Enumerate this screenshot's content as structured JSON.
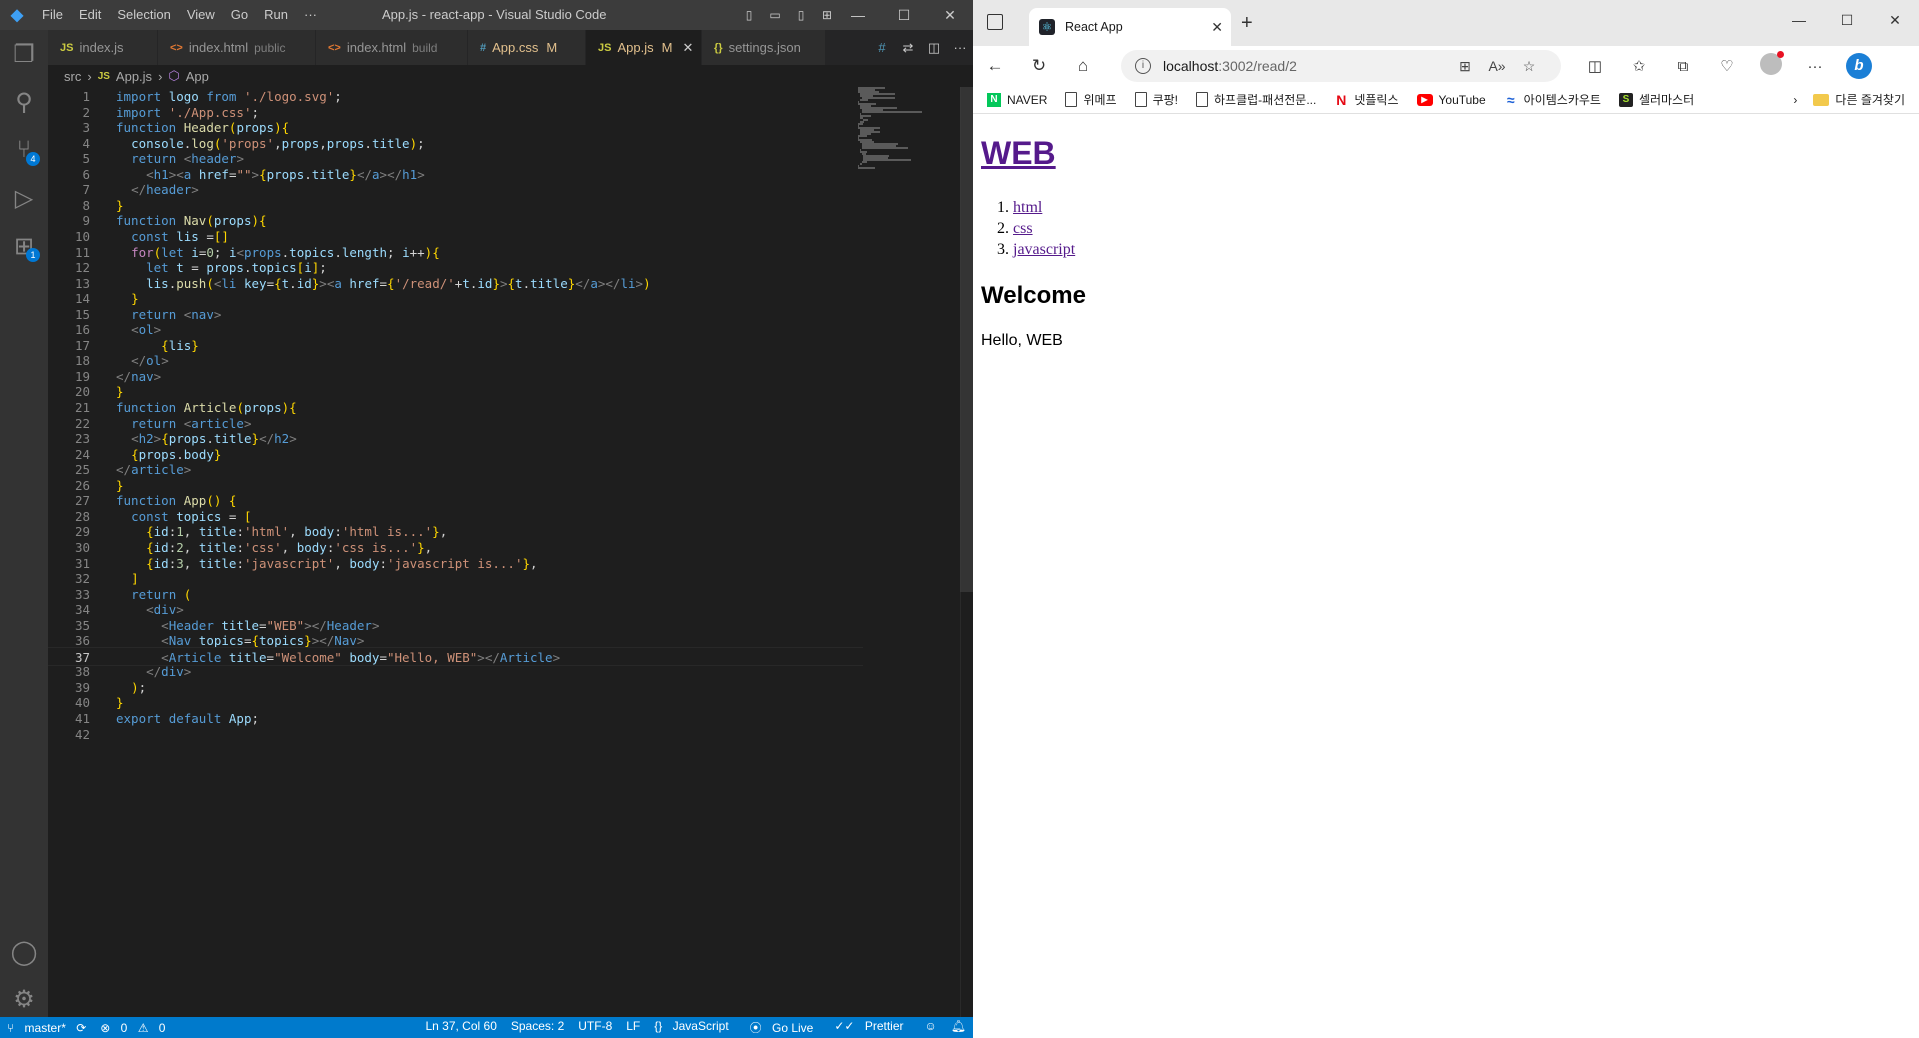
{
  "vscode": {
    "menu": [
      "File",
      "Edit",
      "Selection",
      "View",
      "Go",
      "Run",
      "···"
    ],
    "window_title": "App.js - react-app - Visual Studio Code",
    "tabs": [
      {
        "icon": "JS",
        "name": "index.js",
        "sub": "",
        "mod": ""
      },
      {
        "icon": "<>",
        "name": "index.html",
        "sub": "public",
        "mod": ""
      },
      {
        "icon": "<>",
        "name": "index.html",
        "sub": "build",
        "mod": ""
      },
      {
        "icon": "#",
        "name": "App.css",
        "sub": "",
        "mod": "M"
      },
      {
        "icon": "JS",
        "name": "App.js",
        "sub": "",
        "mod": "M"
      },
      {
        "icon": "{}",
        "name": "settings.json",
        "sub": "",
        "mod": ""
      }
    ],
    "tab_overflow_icon": "#",
    "breadcrumb": {
      "folder": "src",
      "file_icon": "JS",
      "file": "App.js",
      "symbol": "App"
    },
    "activity_badges": {
      "scm": "4",
      "extensions": "1"
    },
    "code_lines": [
      "import logo from './logo.svg';",
      "import './App.css';",
      "function Header(props){",
      "  console.log('props',props,props.title);",
      "  return <header>",
      "    <h1><a href=\"\">{props.title}</a></h1>",
      "  </header>",
      "}",
      "function Nav(props){",
      "  const lis =[]",
      "  for(let i=0; i<props.topics.length; i++){",
      "    let t = props.topics[i];",
      "    lis.push(<li key={t.id}><a href={'/read/'+t.id}>{t.title}</a></li>)",
      "  }",
      "  return <nav>",
      "  <ol>",
      "      {lis}",
      "  </ol>",
      "</nav>",
      "}",
      "function Article(props){",
      "  return <article>",
      "  <h2>{props.title}</h2>",
      "  {props.body}",
      "</article>",
      "}",
      "function App() {",
      "  const topics = [",
      "    {id:1, title:'html', body:'html is...'},",
      "    {id:2, title:'css', body:'css is...'},",
      "    {id:3, title:'javascript', body:'javascript is...'},",
      "  ]",
      "  return (",
      "    <div>",
      "      <Header title=\"WEB\"></Header>",
      "      <Nav topics={topics}></Nav>",
      "      <Article title=\"Welcome\" body=\"Hello, WEB\"></Article>",
      "    </div>",
      "  );",
      "}",
      "export default App;",
      ""
    ],
    "current_line": 37,
    "status": {
      "branch": "master*",
      "errors": "0",
      "warnings": "0",
      "position": "Ln 37, Col 60",
      "spaces": "Spaces: 2",
      "encoding": "UTF-8",
      "eol": "LF",
      "language": "JavaScript",
      "golive": "Go Live",
      "prettier": "Prettier"
    }
  },
  "browser": {
    "tab_title": "React App",
    "url_host": "localhost",
    "url_path": ":3002/read/2",
    "favorites": [
      {
        "icon": "naver",
        "label": "NAVER"
      },
      {
        "icon": "doc",
        "label": "위메프"
      },
      {
        "icon": "doc",
        "label": "쿠팡!"
      },
      {
        "icon": "doc",
        "label": "하프클럽-패션전문..."
      },
      {
        "icon": "netflix",
        "label": "넷플릭스"
      },
      {
        "icon": "youtube",
        "label": "YouTube"
      },
      {
        "icon": "wave",
        "label": "아이템스카우트"
      },
      {
        "icon": "seller",
        "label": "셀러마스터"
      }
    ],
    "other_favorites": "다른 즐겨찾기",
    "page": {
      "heading": "WEB",
      "nav_items": [
        "html",
        "css",
        "javascript"
      ],
      "article_title": "Welcome",
      "article_body": "Hello, WEB"
    }
  },
  "colors": {
    "vscode_bg": "#1e1e1e",
    "status_bar": "#007acc",
    "keyword": "#569cd6",
    "control": "#c586c0",
    "string": "#ce9178",
    "function": "#dcdcaa",
    "variable": "#9cdcfe",
    "tag": "#4ec9b0",
    "visited_link": "#551a8b"
  }
}
